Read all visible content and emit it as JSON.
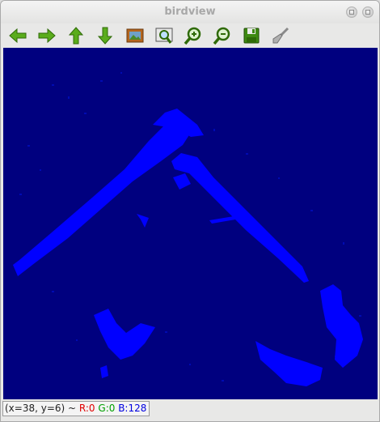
{
  "window": {
    "title": "birdview"
  },
  "toolbar": {
    "tools": [
      {
        "name": "pan-left",
        "icon": "arrow-left-icon",
        "color": "#4a9a10"
      },
      {
        "name": "pan-right",
        "icon": "arrow-right-icon",
        "color": "#4a9a10"
      },
      {
        "name": "pan-up",
        "icon": "arrow-up-icon",
        "color": "#4a9a10"
      },
      {
        "name": "pan-down",
        "icon": "arrow-down-icon",
        "color": "#4a9a10"
      },
      {
        "name": "zoom-fit",
        "icon": "picture-frame-icon",
        "color": "#b5651d"
      },
      {
        "name": "zoom-region",
        "icon": "zoom-image-icon",
        "color": "#3a7a10"
      },
      {
        "name": "zoom-in",
        "icon": "zoom-in-icon",
        "color": "#3a7a10"
      },
      {
        "name": "zoom-out",
        "icon": "zoom-out-icon",
        "color": "#3a7a10"
      },
      {
        "name": "save",
        "icon": "save-disk-icon",
        "color": "#3a7a10"
      },
      {
        "name": "properties",
        "icon": "brush-icon",
        "color": "#8a8a8a"
      }
    ]
  },
  "canvas": {
    "background": "#00007f",
    "foreground": "#0000ff"
  },
  "status": {
    "coords": "(x=38, y=6) ~",
    "r": "R:0",
    "g": "G:0",
    "b": "B:128"
  }
}
